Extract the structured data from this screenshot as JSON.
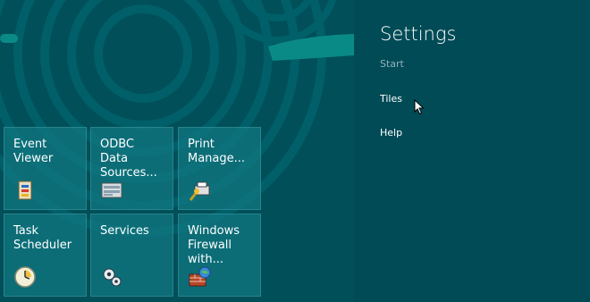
{
  "start_screen": {
    "tiles": [
      {
        "label": "Event\nViewer",
        "icon": "event-viewer-icon"
      },
      {
        "label": "ODBC\nData\nSources...",
        "icon": "odbc-data-sources-icon"
      },
      {
        "label": "Print\nManage...",
        "icon": "print-management-icon"
      },
      {
        "label": "Task\nScheduler",
        "icon": "task-scheduler-icon"
      },
      {
        "label": "Services",
        "icon": "services-gear-icon"
      },
      {
        "label": "Windows\nFirewall\nwith...",
        "icon": "windows-firewall-icon"
      }
    ]
  },
  "settings": {
    "title": "Settings",
    "subtitle": "Start",
    "items": [
      {
        "label": "Tiles"
      },
      {
        "label": "Help"
      }
    ]
  },
  "colors": {
    "background": "#004f59",
    "pane": "#004b56",
    "tile": "#107882",
    "accent": "#0a8a86"
  }
}
